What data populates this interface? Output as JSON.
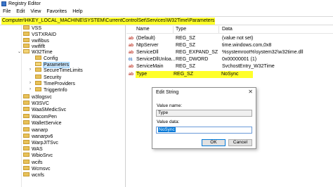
{
  "window": {
    "title": "Registry Editor"
  },
  "menu": [
    "File",
    "Edit",
    "View",
    "Favorites",
    "Help"
  ],
  "address": "Computer\\HKEY_LOCAL_MACHINE\\SYSTEM\\CurrentControlSet\\Services\\W32Time\\Parameters",
  "tree": {
    "items": [
      {
        "label": "VSS",
        "expanded": false
      },
      {
        "label": "VSTXRAID",
        "expanded": false
      },
      {
        "label": "vwifibus",
        "expanded": false
      },
      {
        "label": "vwififlt",
        "expanded": false
      },
      {
        "label": "W32Time",
        "expanded": true
      },
      {
        "label": "Config",
        "expanded": false
      },
      {
        "label": "Parameters",
        "expanded": false,
        "selected": true
      },
      {
        "label": "SecureTimeLimits",
        "expanded": false
      },
      {
        "label": "Security",
        "expanded": false
      },
      {
        "label": "TimeProviders",
        "expanded": false
      },
      {
        "label": "TriggerInfo",
        "expanded": false
      },
      {
        "label": "w3logsvc",
        "expanded": false
      },
      {
        "label": "W3SVC",
        "expanded": false
      },
      {
        "label": "WaaSMedicSvc",
        "expanded": false
      },
      {
        "label": "WacomPen",
        "expanded": false
      },
      {
        "label": "WalletService",
        "expanded": false
      },
      {
        "label": "wanarp",
        "expanded": false
      },
      {
        "label": "wanarpv6",
        "expanded": false
      },
      {
        "label": "WarpJITSvc",
        "expanded": false
      },
      {
        "label": "WAS",
        "expanded": false
      },
      {
        "label": "WbioSrvc",
        "expanded": false
      },
      {
        "label": "wcifs",
        "expanded": false
      },
      {
        "label": "Wcmsvc",
        "expanded": false
      },
      {
        "label": "wcnfs",
        "expanded": false
      }
    ]
  },
  "list": {
    "headers": [
      "Name",
      "Type",
      "Data"
    ],
    "rows": [
      {
        "icon": "string-value-icon",
        "name": "(Default)",
        "type": "REG_SZ",
        "data": "(value not set)"
      },
      {
        "icon": "string-value-icon",
        "name": "NtpServer",
        "type": "REG_SZ",
        "data": "time.windows.com,0x8"
      },
      {
        "icon": "string-value-icon",
        "name": "ServiceDll",
        "type": "REG_EXPAND_SZ",
        "data": "%systemroot%\\system32\\w32time.dll"
      },
      {
        "icon": "binary-value-icon",
        "name": "ServiceDllUnloa...",
        "type": "REG_DWORD",
        "data": "0x00000001 (1)"
      },
      {
        "icon": "string-value-icon",
        "name": "ServiceMain",
        "type": "REG_SZ",
        "data": "SvchostEntry_W32Time"
      },
      {
        "icon": "string-value-icon",
        "name": "Type",
        "type": "REG_SZ",
        "data": "NoSync"
      }
    ]
  },
  "dialog": {
    "title": "Edit String",
    "close": "✕",
    "value_name_label": "Value name:",
    "value_name": "Type",
    "value_data_label": "Value data:",
    "value_data": "NoSync",
    "ok_label": "OK",
    "cancel_label": "Cancel"
  },
  "colors": {
    "highlight": "#ffff2a",
    "selection": "#0078d7"
  }
}
